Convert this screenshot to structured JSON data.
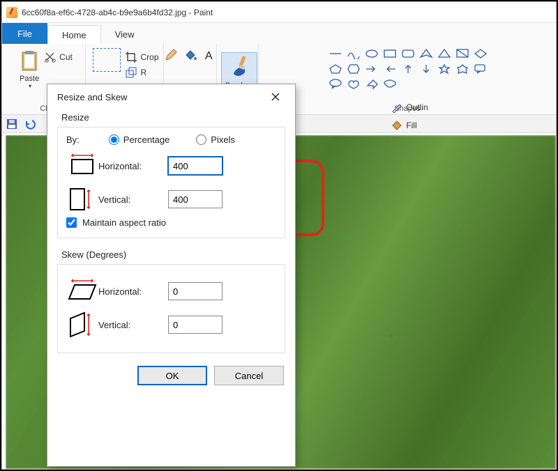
{
  "title": {
    "filename": "6cc60f8a-ef6c-4728-ab4c-b9e9a6b4fd32.jpg",
    "app": "Paint"
  },
  "tabs": {
    "file": "File",
    "home": "Home",
    "view": "View"
  },
  "ribbon": {
    "clipboard": {
      "paste": "Paste",
      "cut": "Cut",
      "group": "Cl"
    },
    "image": {
      "crop": "Crop",
      "resize_partial": "R"
    },
    "brushes": "Brushes",
    "shapes": {
      "group": "Shapes",
      "outline": "Outlin",
      "fill": "Fill"
    }
  },
  "dialog": {
    "title": "Resize and Skew",
    "resize": {
      "legend": "Resize",
      "by": "By:",
      "percentage": "Percentage",
      "pixels": "Pixels",
      "horizontal_label": "Horizontal:",
      "vertical_label": "Vertical:",
      "horizontal_value": "400",
      "vertical_value": "400",
      "maintain": "Maintain aspect ratio"
    },
    "skew": {
      "legend": "Skew (Degrees)",
      "horizontal_label": "Horizontal:",
      "vertical_label": "Vertical:",
      "horizontal_value": "0",
      "vertical_value": "0"
    },
    "ok": "OK",
    "cancel": "Cancel"
  }
}
